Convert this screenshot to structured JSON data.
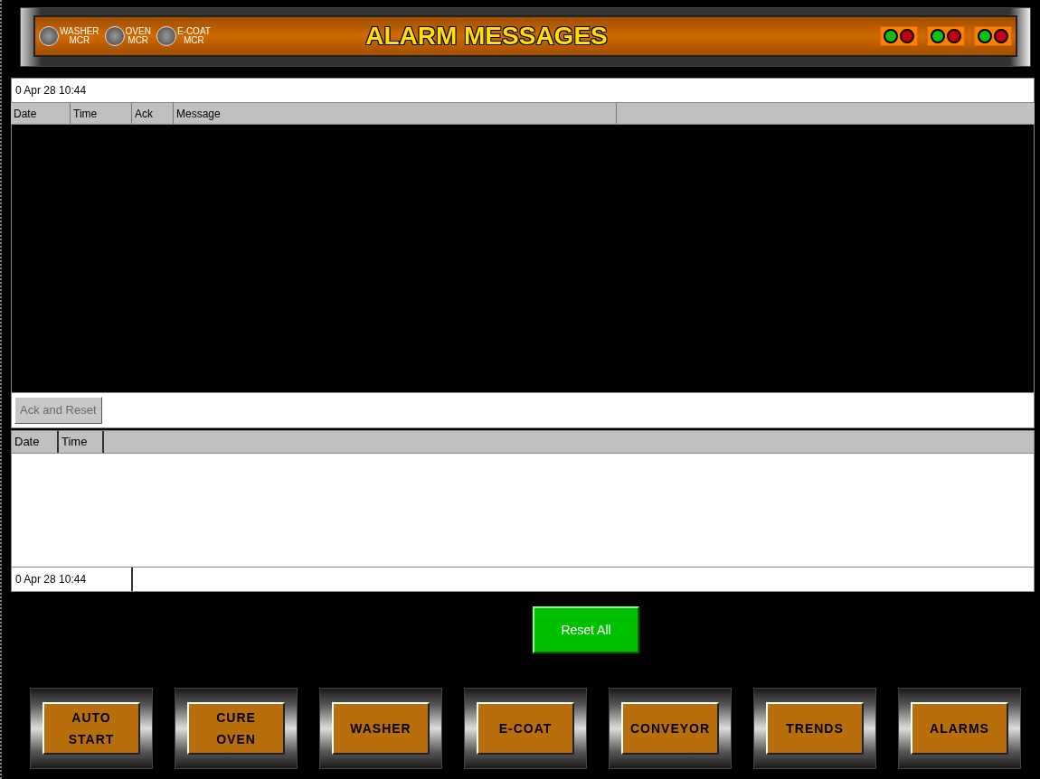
{
  "header": {
    "title": "ALARM MESSAGES",
    "mcr_indicators": [
      {
        "lines": [
          "WASHER",
          "MCR"
        ],
        "on": false
      },
      {
        "lines": [
          "OVEN",
          "MCR"
        ],
        "on": false
      },
      {
        "lines": [
          "E-COAT",
          "MCR"
        ],
        "on": false
      }
    ],
    "lamp_groups": [
      {
        "lamps": [
          {
            "color": "#10c010"
          },
          {
            "color": "#c00010"
          }
        ]
      },
      {
        "lamps": [
          {
            "color": "#10c010"
          },
          {
            "color": "#c00010"
          }
        ]
      },
      {
        "lamps": [
          {
            "color": "#10c010"
          },
          {
            "color": "#c00010"
          }
        ]
      }
    ]
  },
  "active_alarms": {
    "timestamp": "0 Apr 28 10:44",
    "columns": [
      "Date",
      "Time",
      "Ack",
      "Message"
    ]
  },
  "ack_button": {
    "label": "Ack and Reset",
    "disabled": true
  },
  "history": {
    "columns": [
      "Date",
      "Time"
    ],
    "timestamp": "0 Apr 28 10:44"
  },
  "reset_all": {
    "label": "Reset All"
  },
  "nav_buttons": [
    {
      "lines": [
        "AUTO",
        "START"
      ]
    },
    {
      "lines": [
        "CURE",
        "OVEN"
      ]
    },
    {
      "lines": [
        "WASHER"
      ]
    },
    {
      "lines": [
        "E-COAT"
      ]
    },
    {
      "lines": [
        "CONVEYOR"
      ]
    },
    {
      "lines": [
        "TRENDS"
      ]
    },
    {
      "lines": [
        "ALARMS"
      ]
    }
  ]
}
